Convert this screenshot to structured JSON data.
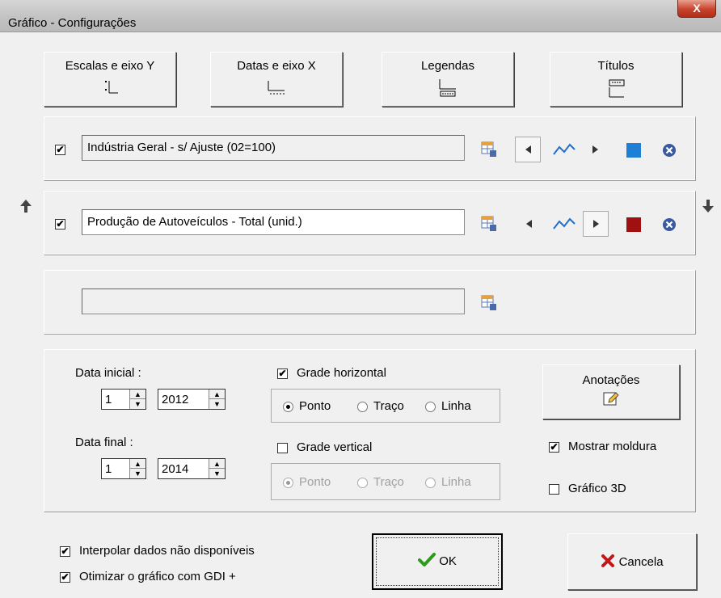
{
  "window": {
    "title": "Gráfico - Configurações",
    "close_label": "X"
  },
  "tabs": [
    {
      "label": "Escalas e eixo Y"
    },
    {
      "label": "Datas e eixo X"
    },
    {
      "label": "Legendas"
    },
    {
      "label": "Títulos"
    }
  ],
  "series": [
    {
      "name": "Indústria Geral - s/ Ajuste (02=100)",
      "checked": true,
      "color": "#1e7fd4"
    },
    {
      "name": "Produção de Autoveículos - Total (unid.)",
      "checked": true,
      "color": "#a01010"
    },
    {
      "name": ""
    }
  ],
  "dates": {
    "start_label": "Data inicial :",
    "start_month": "1",
    "start_year": "2012",
    "end_label": "Data final :",
    "end_month": "1",
    "end_year": "2014"
  },
  "grid": {
    "horizontal_label": "Grade horizontal",
    "horizontal_checked": true,
    "vertical_label": "Grade vertical",
    "vertical_checked": false,
    "options": [
      "Ponto",
      "Traço",
      "Linha"
    ]
  },
  "annotations_label": "Anotações",
  "frame": {
    "show_frame_label": "Mostrar moldura",
    "show_frame_checked": true,
    "chart3d_label": "Gráfico 3D",
    "chart3d_checked": false
  },
  "footer": {
    "interpolate_label": "Interpolar dados não disponíveis",
    "optimize_label": "Otimizar o gráfico com GDI +",
    "ok_label": "OK",
    "cancel_label": "Cancela"
  },
  "check_mark": "✔"
}
